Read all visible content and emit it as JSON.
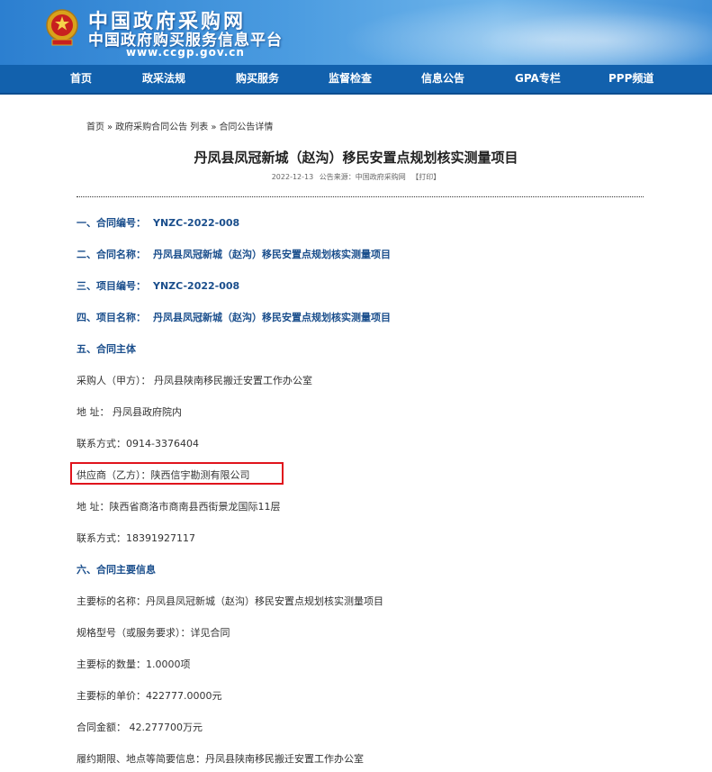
{
  "header": {
    "title_line1": "中国政府采购网",
    "title_line2": "中国政府购买服务信息平台",
    "domain": "www.ccgp.gov.cn"
  },
  "nav": {
    "items": [
      "首页",
      "政采法规",
      "购买服务",
      "监督检查",
      "信息公告",
      "GPA专栏",
      "PPP频道"
    ]
  },
  "breadcrumb": {
    "home": "首页",
    "sep": "»",
    "list": "政府采购合同公告 列表",
    "current": "合同公告详情"
  },
  "article": {
    "title": "丹凤县凤冠新城（赵沟）移民安置点规划核实测量项目",
    "date": "2022-12-13",
    "source_label": "公告来源：",
    "source": "中国政府采购网",
    "print": "【打印】"
  },
  "content": {
    "contract_no_label": "一、合同编号：",
    "contract_no": "YNZC-2022-008",
    "contract_name_label": "二、合同名称：",
    "contract_name": "丹凤县凤冠新城（赵沟）移民安置点规划核实测量项目",
    "project_no_label": "三、项目编号：",
    "project_no": "YNZC-2022-008",
    "project_name_label": "四、项目名称：",
    "project_name": "丹凤县凤冠新城（赵沟）移民安置点规划核实测量项目",
    "section5": "五、合同主体",
    "buyer": "采购人（甲方）： 丹凤县陕南移民搬迁安置工作办公室",
    "buyer_address": "地 址： 丹凤县政府院内",
    "buyer_contact": "联系方式：0914-3376404",
    "supplier": "供应商（乙方）：陕西信宇勘测有限公司",
    "supplier_address": "地 址：陕西省商洛市商南县西街景龙国际11层",
    "supplier_contact": "联系方式：18391927117",
    "section6": "六、合同主要信息",
    "subject_name": "主要标的名称：丹凤县凤冠新城（赵沟）移民安置点规划核实测量项目",
    "spec": "规格型号（或服务要求）：详见合同",
    "quantity": "主要标的数量：1.0000项",
    "unit_price": "主要标的单价：422777.0000元",
    "amount": "合同金额： 42.277700万元",
    "period": "履约期限、地点等简要信息：丹凤县陕南移民搬迁安置工作办公室"
  },
  "colors": {
    "nav_bg": "#1261ad",
    "heading": "#1a4e8c",
    "highlight_border": "#e0141c"
  }
}
